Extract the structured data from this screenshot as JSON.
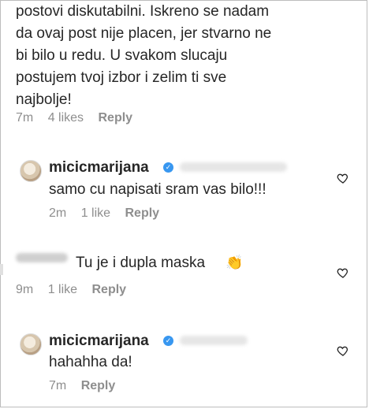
{
  "comments": [
    {
      "lines": [
        "postovi diskutabilni. Iskreno se nadam",
        "da ovaj post nije placen, jer stvarno ne",
        "bi bilo u redu. U svakom slucaju",
        "postujem tvoj izbor i zelim ti sve",
        "najbolje!"
      ],
      "time": "7m",
      "likes": "4 likes",
      "reply": "Reply"
    },
    {
      "username": "micicmarijana",
      "text": "samo cu napisati sram vas bilo!!!",
      "time": "2m",
      "likes": "1 like",
      "reply": "Reply",
      "icons": [
        "avatar",
        "verified-badge-icon",
        "heart-icon"
      ]
    },
    {
      "text": "Tu je i dupla maska",
      "emoji": "👏",
      "time": "9m",
      "likes": "1 like",
      "reply": "Reply",
      "icons": [
        "clapping-hands-icon",
        "heart-icon"
      ]
    },
    {
      "username": "micicmarijana",
      "text": "hahahha da!",
      "time": "7m",
      "reply": "Reply",
      "icons": [
        "avatar",
        "verified-badge-icon",
        "heart-icon"
      ]
    }
  ],
  "colors": {
    "text": "#262626",
    "meta": "#8e8e8e",
    "verified": "#3897f0"
  }
}
